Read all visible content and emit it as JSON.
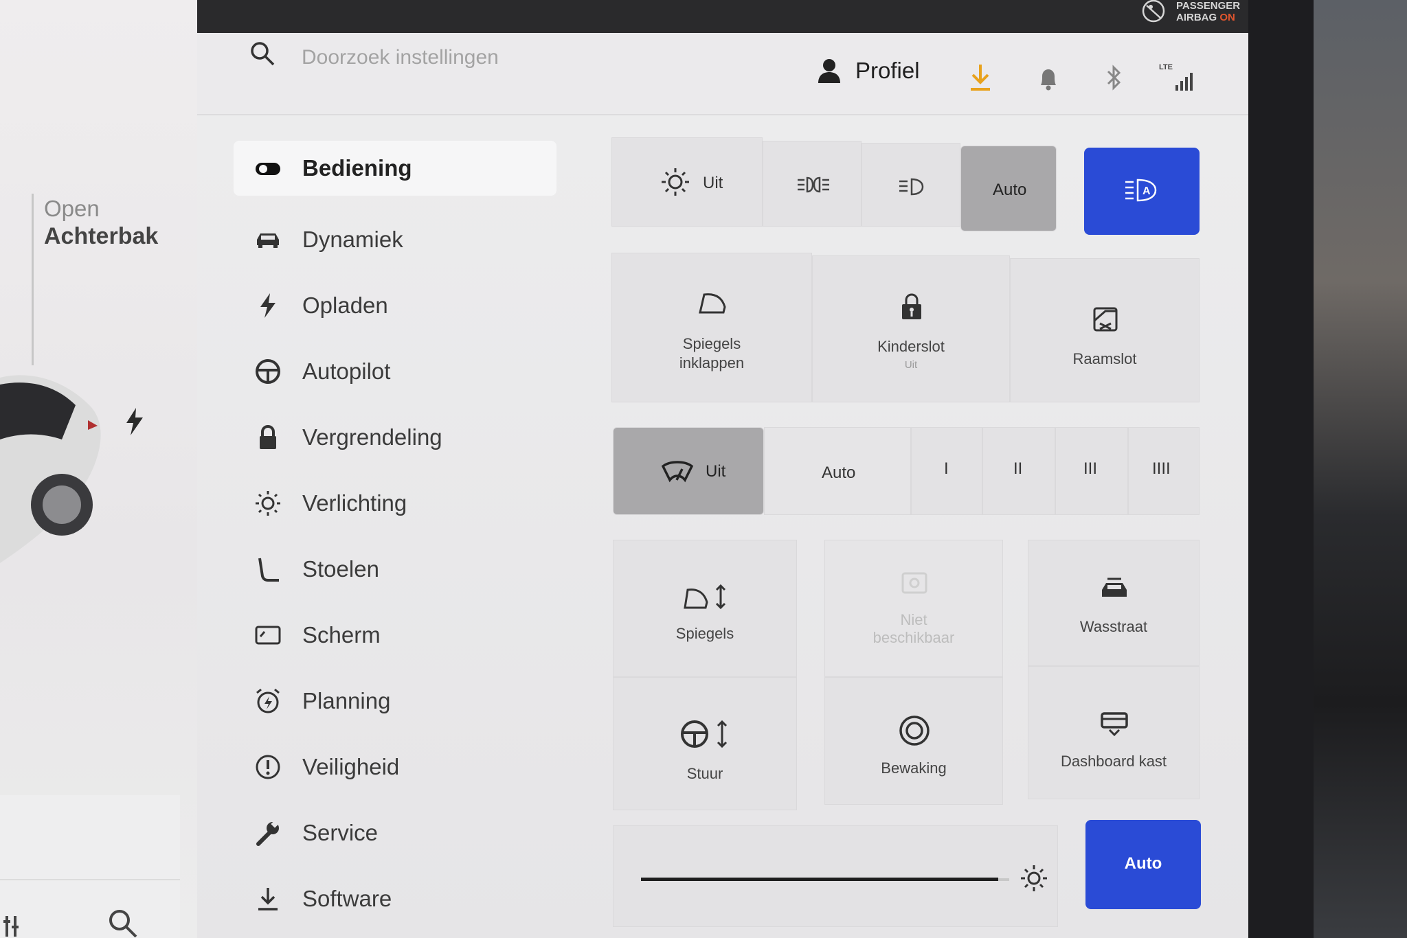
{
  "status_bar": {
    "airbag_line1": "PASSENGER",
    "airbag_line2": "AIRBAG",
    "airbag_state": "ON"
  },
  "car_panel": {
    "trunk_action": "Open",
    "trunk_name": "Achterbak"
  },
  "header": {
    "search_placeholder": "Doorzoek instellingen",
    "profile_label": "Profiel",
    "network": "LTE"
  },
  "sidebar": {
    "items": [
      {
        "label": "Bediening",
        "icon": "toggle-icon",
        "active": true
      },
      {
        "label": "Dynamiek",
        "icon": "car-icon"
      },
      {
        "label": "Opladen",
        "icon": "bolt-icon"
      },
      {
        "label": "Autopilot",
        "icon": "steering-wheel-icon"
      },
      {
        "label": "Vergrendeling",
        "icon": "lock-icon"
      },
      {
        "label": "Verlichting",
        "icon": "sun-icon"
      },
      {
        "label": "Stoelen",
        "icon": "seat-icon"
      },
      {
        "label": "Scherm",
        "icon": "display-icon"
      },
      {
        "label": "Planning",
        "icon": "alarm-clock-icon"
      },
      {
        "label": "Veiligheid",
        "icon": "alert-icon"
      },
      {
        "label": "Service",
        "icon": "wrench-icon"
      },
      {
        "label": "Software",
        "icon": "download-icon"
      }
    ]
  },
  "lights": {
    "off_label": "Uit",
    "auto_label": "Auto",
    "selected": "Auto"
  },
  "quick_controls": {
    "mirrors_fold_line1": "Spiegels",
    "mirrors_fold_line2": "inklappen",
    "child_lock": "Kinderslot",
    "child_lock_state": "Uit",
    "window_lock": "Raamslot"
  },
  "wipers": {
    "off_label": "Uit",
    "auto_label": "Auto",
    "speeds": [
      "I",
      "II",
      "III",
      "IIII"
    ],
    "selected": "Uit"
  },
  "adjust_controls": {
    "mirrors": "Spiegels",
    "unavailable_line1": "Niet",
    "unavailable_line2": "beschikbaar",
    "car_wash": "Wasstraat",
    "steering": "Stuur",
    "sentry": "Bewaking",
    "glovebox": "Dashboard kast"
  },
  "brightness": {
    "auto_label": "Auto",
    "level": 0.97
  },
  "colors": {
    "accent": "#2a4bd6",
    "download": "#e8a21d",
    "airbag_on": "#e0552e"
  }
}
